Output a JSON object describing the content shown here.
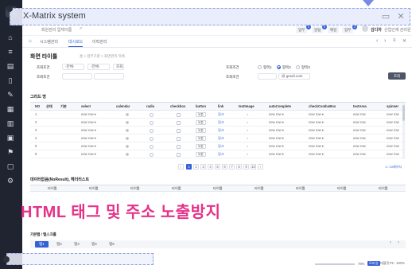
{
  "window": {
    "title": "X-Matrix system",
    "minimize_icon": "window-restore-icon",
    "close_icon": "close-icon"
  },
  "topbar": {
    "company": "회원관리 업체이름",
    "badges": [
      "업무",
      "알림",
      "메일"
    ],
    "badge_counts": [
      "3",
      "5",
      "2"
    ],
    "user_name": "김디자",
    "user_role": "산업인재 관리원"
  },
  "tabs": [
    "시스템관리",
    "대시보드",
    "이력관리"
  ],
  "page": {
    "title": "화면 타이틀",
    "breadcrumb": [
      "홈",
      "업무기준",
      "화면관리 목록"
    ]
  },
  "form": {
    "select_label": "조회조건",
    "select_a": "-전체-",
    "select_b": "-전체-",
    "select_text": "조회",
    "date_label": "조회조건",
    "date_value": "",
    "radio_label": "조회조건",
    "radios": [
      "항목1",
      "항목2",
      "항목3"
    ],
    "email_label": "조회조건",
    "email_domain": "@ gmail.com",
    "search_button": "조회"
  },
  "grid": {
    "title": "그리드 명",
    "columns": [
      "NO",
      "상태",
      "기본",
      "select",
      "calendar",
      "radio",
      "checkbox",
      "button",
      "link",
      "textImage",
      "autoComplete",
      "checkComboBox",
      "textArea",
      "spinner"
    ],
    "rows": [
      {
        "no": "1",
        "select": "new row",
        "button": "버튼",
        "link": "링크",
        "auto": "new row",
        "combo": "new row",
        "textarea": "new row",
        "spinner": "new row"
      },
      {
        "no": "2",
        "select": "new row",
        "button": "버튼",
        "link": "링크",
        "auto": "new row",
        "combo": "new row",
        "textarea": "new row",
        "spinner": "new row"
      },
      {
        "no": "3",
        "select": "new row",
        "button": "버튼",
        "link": "링크",
        "auto": "new row",
        "combo": "new row",
        "textarea": "new row",
        "spinner": "new row"
      },
      {
        "no": "4",
        "select": "new row",
        "button": "버튼",
        "link": "링크",
        "auto": "new row",
        "combo": "new row",
        "textarea": "new row",
        "spinner": "new row"
      },
      {
        "no": "5",
        "select": "new row",
        "button": "버튼",
        "link": "링크",
        "auto": "new row",
        "combo": "new row",
        "textarea": "new row",
        "spinner": "new row"
      },
      {
        "no": "6",
        "select": "new row",
        "button": "버튼",
        "link": "링크",
        "auto": "new row",
        "combo": "new row",
        "textarea": "new row",
        "spinner": "new row"
      }
    ],
    "pager": [
      "1",
      "2",
      "3",
      "4",
      "5",
      "6",
      "7",
      "8",
      "9",
      "10"
    ],
    "page_info": "1 / 10페이지"
  },
  "grid2": {
    "title": "데이터없음(NoResult), 헤더리스트",
    "columns": [
      "타이틀",
      "타이틀",
      "타이틀",
      "타이틀",
      "타이틀",
      "타이틀",
      "타이틀",
      "타이틀",
      "타이틀"
    ]
  },
  "overlay": {
    "headline": "HTML 태그 및 주소 노출방지"
  },
  "tabs2": {
    "title": "기본탭 / 탭스크롤",
    "items": [
      "탭1",
      "탭2",
      "탭3",
      "탭4",
      "탭5"
    ]
  },
  "footer": {
    "zoom_label": "78%",
    "modes": [
      "모바일",
      "태블릿",
      "PC",
      "전체화면"
    ],
    "right_text": "100%"
  }
}
